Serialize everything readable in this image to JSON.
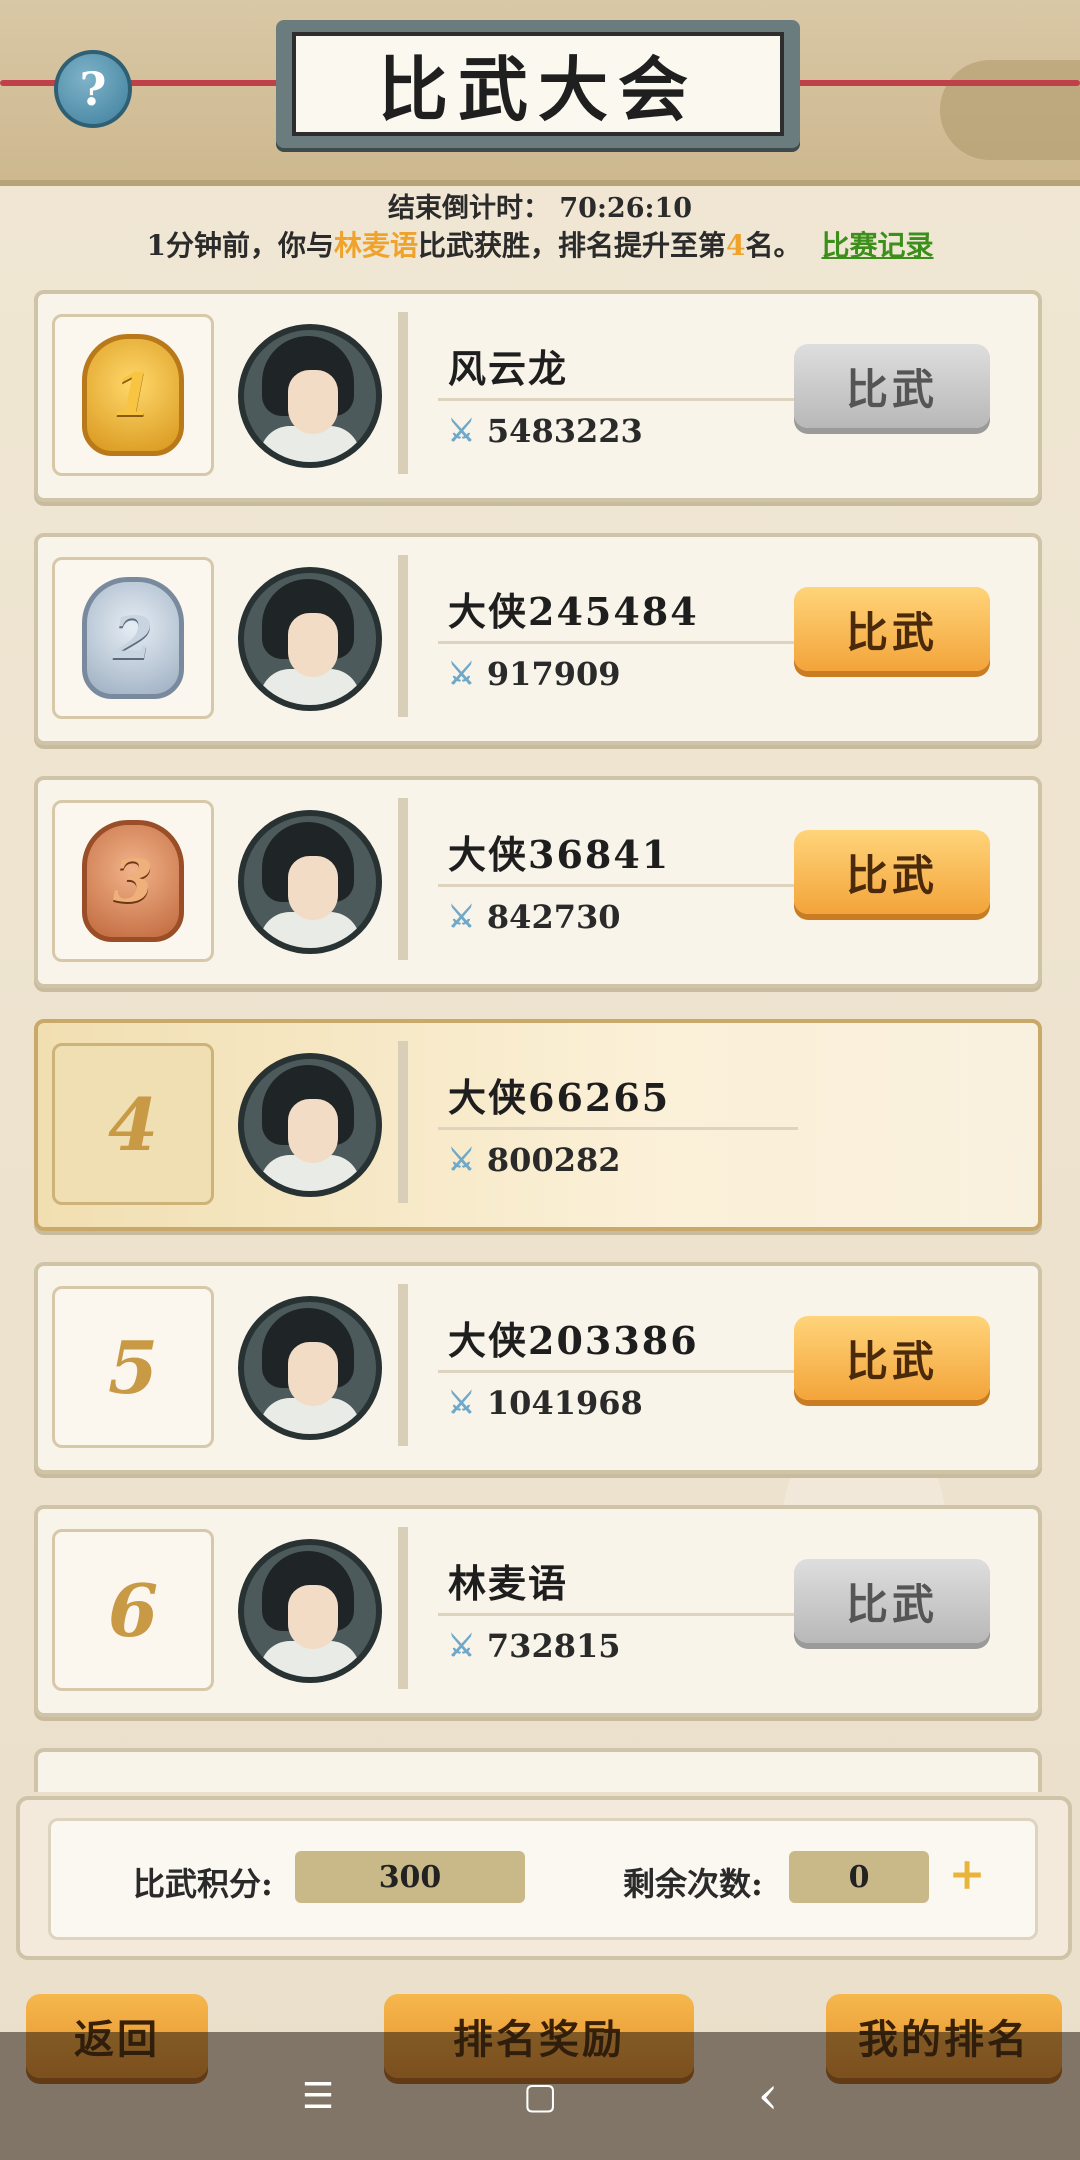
{
  "header": {
    "title": "比武大会",
    "help_icon": "?",
    "countdown_label": "结束倒计时：",
    "countdown_value": "70:26:10",
    "news_prefix": "1分钟前，你与",
    "news_name": "林麦语",
    "news_middle": "比武获胜，排名提升至第",
    "news_rank": "4",
    "news_suffix": "名。",
    "records_link": "比赛记录"
  },
  "rows": [
    {
      "rank": "1",
      "name": "风云龙",
      "power": "5483223",
      "button": "比武",
      "button_enabled": false
    },
    {
      "rank": "2",
      "name": "大侠245484",
      "power": "917909",
      "button": "比武",
      "button_enabled": true
    },
    {
      "rank": "3",
      "name": "大侠36841",
      "power": "842730",
      "button": "比武",
      "button_enabled": true
    },
    {
      "rank": "4",
      "name": "大侠66265",
      "power": "800282",
      "button": "",
      "button_enabled": false
    },
    {
      "rank": "5",
      "name": "大侠203386",
      "power": "1041968",
      "button": "比武",
      "button_enabled": true
    },
    {
      "rank": "6",
      "name": "林麦语",
      "power": "732815",
      "button": "比武",
      "button_enabled": false
    }
  ],
  "stats": {
    "points_label": "比武积分:",
    "points_value": "300",
    "remaining_label": "剩余次数:",
    "remaining_value": "0",
    "plus_icon": "+"
  },
  "actions": {
    "back": "返回",
    "rank_rewards": "排名奖励",
    "my_rank": "我的排名"
  },
  "navbar": {
    "menu_icon": "☰",
    "home_icon": "▢",
    "back_icon": "‹"
  },
  "colors": {
    "highlight": "#f0a32b",
    "link": "#3b8f1a",
    "button_orange": "#f3a43a",
    "button_gray": "#b8b8b8"
  }
}
